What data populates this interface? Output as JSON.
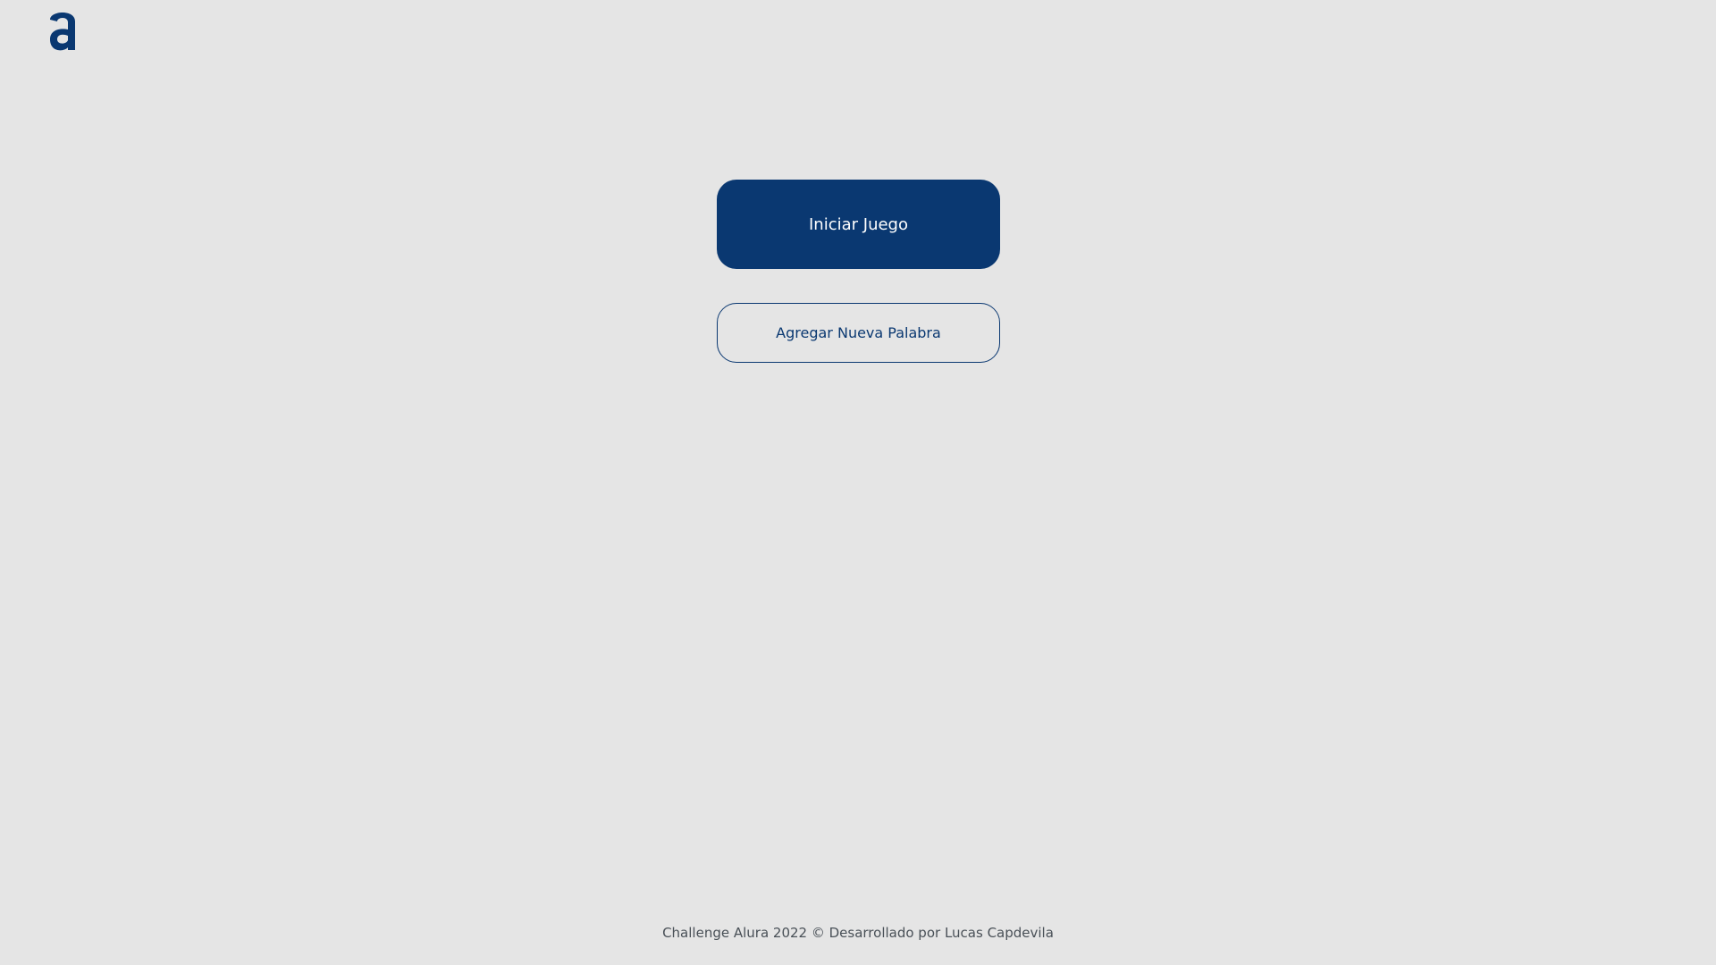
{
  "header": {
    "logo_icon": "alura-a-logo-icon",
    "logo_color": "#0a3871"
  },
  "main": {
    "start_button_label": "Iniciar Juego",
    "add_word_button_label": "Agregar Nueva Palabra"
  },
  "footer": {
    "text": "Challenge Alura 2022 © Desarrollado por Lucas Capdevila"
  },
  "colors": {
    "background": "#e5e5e5",
    "primary": "#0a3871",
    "primary_text": "#ffffff",
    "footer_text": "#495057"
  }
}
